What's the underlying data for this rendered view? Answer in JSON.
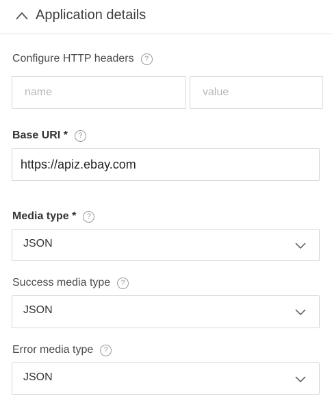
{
  "header": {
    "title": "Application details"
  },
  "http_headers": {
    "label": "Configure HTTP headers",
    "name_placeholder": "name",
    "value_placeholder": "value"
  },
  "base_uri": {
    "label": "Base URI *",
    "value": "https://apiz.ebay.com"
  },
  "media_type": {
    "label": "Media type *",
    "value": "JSON"
  },
  "success_media_type": {
    "label": "Success media type",
    "value": "JSON"
  },
  "error_media_type": {
    "label": "Error media type",
    "value": "JSON"
  },
  "help_glyph": "?",
  "icons": {
    "collapse": "chevron-up-icon",
    "help": "question-circle-icon",
    "dropdown": "chevron-down-icon"
  }
}
